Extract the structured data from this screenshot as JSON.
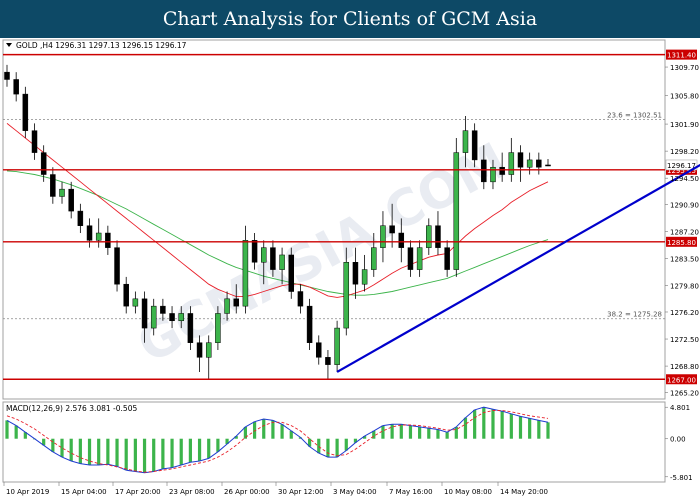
{
  "header": {
    "title": "Chart Analysis for Clients of GCM Asia"
  },
  "watermark": "GCMASIA.COM",
  "chart_data": {
    "type": "candlestick",
    "symbol_info": "GOLD ,H4  1296.31 1297.13 1296.15 1296.17",
    "price_axis": {
      "ylim": [
        1264.3,
        1313.4
      ],
      "ticks": [
        "1309.70",
        "1305.80",
        "1301.90",
        "1298.20",
        "1294.50",
        "1290.90",
        "1287.20",
        "1283.50",
        "1279.80",
        "1276.20",
        "1272.50",
        "1268.80",
        "1265.20"
      ]
    },
    "x_labels": [
      "10 Apr 2019",
      "15 Apr 04:00",
      "17 Apr 20:00",
      "23 Apr 08:00",
      "26 Apr 00:00",
      "30 Apr 12:00",
      "3 May 04:00",
      "7 May 16:00",
      "10 May 08:00",
      "14 May 20:00"
    ],
    "horizontal_levels": [
      {
        "value": 1311.4,
        "label": "1311.40",
        "color": "#cc0000"
      },
      {
        "value": 1295.65,
        "label": "1295.65",
        "color": "#cc0000"
      },
      {
        "value": 1285.8,
        "label": "1285.80",
        "color": "#cc0000"
      },
      {
        "value": 1267.0,
        "label": "1267.00",
        "color": "#cc0000"
      }
    ],
    "fibonacci_levels": [
      {
        "value": 1302.51,
        "label": "23.6 = 1302.51"
      },
      {
        "value": 1275.28,
        "label": "38.2 = 1275.28"
      }
    ],
    "current_price": {
      "value": 1296.17,
      "label": "1296.17"
    },
    "trendline": {
      "from": [
        36,
        1268.0
      ],
      "to": [
        77,
        1297.3
      ],
      "color": "#0000cc"
    },
    "candles": [
      [
        1309,
        1310,
        1307,
        1308
      ],
      [
        1308,
        1309,
        1305,
        1306
      ],
      [
        1306,
        1307,
        1300,
        1301
      ],
      [
        1301,
        1302,
        1297,
        1298
      ],
      [
        1298,
        1299,
        1294,
        1295
      ],
      [
        1295,
        1296,
        1291,
        1292
      ],
      [
        1292,
        1294,
        1291,
        1293
      ],
      [
        1293,
        1294,
        1289,
        1290
      ],
      [
        1290,
        1291,
        1287,
        1288
      ],
      [
        1288,
        1289,
        1285,
        1286
      ],
      [
        1286,
        1289,
        1285,
        1287
      ],
      [
        1287,
        1288,
        1284,
        1285
      ],
      [
        1285,
        1286,
        1279,
        1280
      ],
      [
        1280,
        1281,
        1276,
        1277
      ],
      [
        1277,
        1279,
        1276,
        1278
      ],
      [
        1278,
        1279,
        1272,
        1274
      ],
      [
        1274,
        1278,
        1273,
        1277
      ],
      [
        1277,
        1278,
        1275,
        1276
      ],
      [
        1276,
        1277,
        1274,
        1275
      ],
      [
        1275,
        1277,
        1274,
        1276
      ],
      [
        1276,
        1277,
        1271,
        1272
      ],
      [
        1272,
        1273,
        1268,
        1270
      ],
      [
        1270,
        1273,
        1267,
        1272
      ],
      [
        1272,
        1277,
        1271,
        1276
      ],
      [
        1276,
        1279,
        1275,
        1278
      ],
      [
        1278,
        1280,
        1276,
        1277
      ],
      [
        1277,
        1288,
        1276,
        1286
      ],
      [
        1286,
        1287,
        1282,
        1283
      ],
      [
        1283,
        1286,
        1280,
        1285
      ],
      [
        1285,
        1286,
        1281,
        1282
      ],
      [
        1282,
        1285,
        1280,
        1284
      ],
      [
        1284,
        1285,
        1278,
        1279
      ],
      [
        1279,
        1280,
        1276,
        1277
      ],
      [
        1277,
        1278,
        1271,
        1272
      ],
      [
        1272,
        1273,
        1269,
        1270
      ],
      [
        1270,
        1271,
        1267,
        1269
      ],
      [
        1269,
        1275,
        1268,
        1274
      ],
      [
        1274,
        1285,
        1273,
        1283
      ],
      [
        1283,
        1285,
        1278,
        1280
      ],
      [
        1280,
        1284,
        1279,
        1282
      ],
      [
        1282,
        1287,
        1281,
        1285
      ],
      [
        1285,
        1290,
        1283,
        1288
      ],
      [
        1288,
        1291,
        1285,
        1287
      ],
      [
        1287,
        1289,
        1283,
        1285
      ],
      [
        1285,
        1286,
        1281,
        1282
      ],
      [
        1282,
        1286,
        1281,
        1285
      ],
      [
        1285,
        1289,
        1284,
        1288
      ],
      [
        1288,
        1290,
        1284,
        1285
      ],
      [
        1285,
        1286,
        1281,
        1282
      ],
      [
        1282,
        1300,
        1281,
        1298
      ],
      [
        1298,
        1303,
        1296,
        1301
      ],
      [
        1301,
        1302,
        1296,
        1297
      ],
      [
        1297,
        1299,
        1293,
        1294
      ],
      [
        1294,
        1297,
        1293,
        1296
      ],
      [
        1296,
        1298,
        1294,
        1295
      ],
      [
        1295,
        1300,
        1294,
        1298
      ],
      [
        1298,
        1299,
        1294,
        1296
      ],
      [
        1296,
        1298,
        1295,
        1297
      ],
      [
        1297,
        1298,
        1295,
        1296
      ],
      [
        1296.31,
        1297.13,
        1296.15,
        1296.17
      ]
    ],
    "ma_red": [
      1302,
      1301,
      1300,
      1299,
      1298,
      1297,
      1296,
      1295,
      1294,
      1293,
      1292,
      1291,
      1290,
      1289,
      1288,
      1287,
      1286,
      1285,
      1284,
      1283,
      1282,
      1281,
      1280,
      1279.3,
      1278.8,
      1278.3,
      1278.3,
      1278.6,
      1279.0,
      1279.4,
      1279.8,
      1280.0,
      1280.0,
      1279.6,
      1279.0,
      1278.4,
      1278.2,
      1278.4,
      1278.8,
      1279.2,
      1279.9,
      1280.7,
      1281.5,
      1282.2,
      1282.7,
      1283.2,
      1283.7,
      1284.0,
      1284.2,
      1285.4,
      1286.6,
      1287.6,
      1288.5,
      1289.4,
      1290.2,
      1291.2,
      1292.0,
      1292.8,
      1293.4,
      1294.0
    ],
    "ma_green": [
      1295.5,
      1295.4,
      1295.2,
      1295.0,
      1294.7,
      1294.4,
      1294.0,
      1293.6,
      1293.1,
      1292.6,
      1292.1,
      1291.5,
      1290.9,
      1290.3,
      1289.6,
      1288.9,
      1288.2,
      1287.5,
      1286.8,
      1286.1,
      1285.4,
      1284.7,
      1284.0,
      1283.4,
      1282.8,
      1282.3,
      1281.9,
      1281.5,
      1281.1,
      1280.8,
      1280.5,
      1280.2,
      1279.9,
      1279.6,
      1279.3,
      1279.0,
      1278.8,
      1278.6,
      1278.5,
      1278.5,
      1278.6,
      1278.8,
      1279.0,
      1279.3,
      1279.6,
      1279.9,
      1280.2,
      1280.5,
      1280.8,
      1281.3,
      1281.8,
      1282.3,
      1282.8,
      1283.3,
      1283.8,
      1284.3,
      1284.8,
      1285.3,
      1285.7,
      1286.1
    ],
    "macd": {
      "label": "MACD(12,26,9) 2.576 3.081 -0.505",
      "ylim": [
        -6.6,
        5.6
      ],
      "ticks": [
        "4.801",
        "0.00",
        "-5.801"
      ],
      "histogram": [
        2.8,
        2.0,
        1.0,
        0.0,
        -1.0,
        -2.0,
        -2.8,
        -3.4,
        -3.8,
        -4.0,
        -4.0,
        -3.9,
        -4.2,
        -4.8,
        -5.0,
        -5.2,
        -5.0,
        -4.6,
        -4.4,
        -4.0,
        -3.6,
        -3.4,
        -3.0,
        -2.0,
        -0.8,
        0.4,
        1.8,
        2.6,
        3.0,
        2.8,
        2.2,
        1.2,
        0.2,
        -1.2,
        -2.2,
        -2.8,
        -2.8,
        -1.8,
        -0.6,
        0.4,
        1.2,
        2.0,
        2.2,
        2.2,
        2.0,
        1.8,
        1.6,
        1.4,
        1.0,
        1.8,
        3.2,
        4.4,
        4.8,
        4.5,
        4.2,
        3.8,
        3.4,
        3.1,
        2.8,
        2.5
      ],
      "signal": [
        3.5,
        3.0,
        2.3,
        1.5,
        0.5,
        -0.5,
        -1.4,
        -2.2,
        -2.9,
        -3.4,
        -3.8,
        -4.0,
        -4.3,
        -4.6,
        -4.9,
        -5.1,
        -5.0,
        -4.8,
        -4.6,
        -4.3,
        -4.0,
        -3.7,
        -3.4,
        -2.8,
        -2.0,
        -1.0,
        0.2,
        1.2,
        2.0,
        2.5,
        2.5,
        2.0,
        1.2,
        0.0,
        -1.2,
        -2.2,
        -2.6,
        -2.4,
        -1.6,
        -0.6,
        0.4,
        1.2,
        1.8,
        2.1,
        2.1,
        2.0,
        1.8,
        1.6,
        1.3,
        1.4,
        2.2,
        3.2,
        4.0,
        4.3,
        4.3,
        4.1,
        3.8,
        3.5,
        3.3,
        3.1
      ]
    }
  }
}
